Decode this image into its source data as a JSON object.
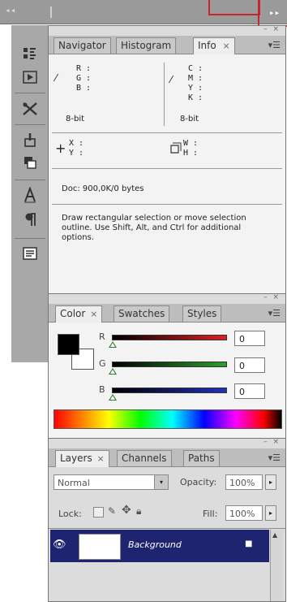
{
  "topbar": {
    "collapse_label": "◂◂",
    "expand_label": "▸▸"
  },
  "info_panel": {
    "tabs": [
      {
        "label": "Navigator"
      },
      {
        "label": "Histogram"
      },
      {
        "label": "Info"
      }
    ],
    "close_label": "×",
    "rgb": {
      "r": "R :",
      "g": "G :",
      "b": "B :"
    },
    "cmyk": {
      "c": "C :",
      "m": "M :",
      "y": "Y :",
      "k": "K :"
    },
    "bitdepth_left": "8-bit",
    "bitdepth_right": "8-bit",
    "xy": {
      "x": "X :",
      "y": "Y :"
    },
    "wh": {
      "w": "W :",
      "h": "H :"
    },
    "doc_info": "Doc: 900,0K/0 bytes",
    "hint": "Draw rectangular selection or move selection outline.  Use Shift, Alt, and Ctrl for additional options."
  },
  "color_panel": {
    "tabs": [
      {
        "label": "Color"
      },
      {
        "label": "Swatches"
      },
      {
        "label": "Styles"
      }
    ],
    "close_label": "×",
    "sliders": [
      {
        "label": "R",
        "value": "0",
        "color": "#d01b1b"
      },
      {
        "label": "G",
        "value": "0",
        "color": "#1f8f1f"
      },
      {
        "label": "B",
        "value": "0",
        "color": "#1b2aa0"
      }
    ],
    "foreground_color": "#000000",
    "background_color": "#ffffff"
  },
  "layers_panel": {
    "tabs": [
      {
        "label": "Layers"
      },
      {
        "label": "Channels"
      },
      {
        "label": "Paths"
      }
    ],
    "close_label": "×",
    "blend_mode": "Normal",
    "opacity_label": "Opacity:",
    "opacity_value": "100%",
    "lock_label": "Lock:",
    "fill_label": "Fill:",
    "fill_value": "100%",
    "layers": [
      {
        "name": "Background",
        "selected": true,
        "visible": true,
        "locked": true
      }
    ]
  }
}
